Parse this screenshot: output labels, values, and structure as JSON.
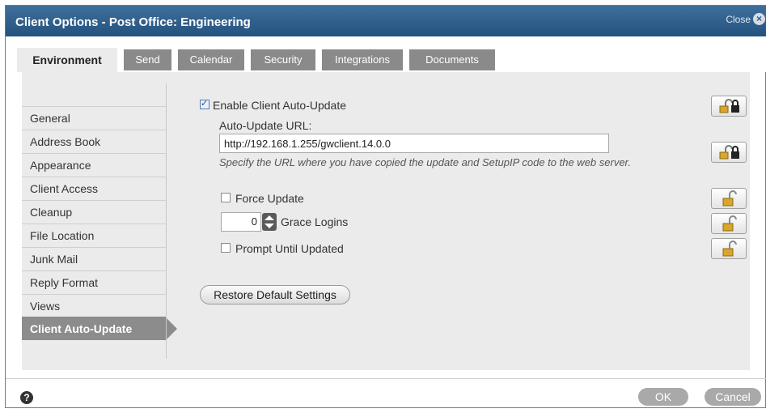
{
  "dialog": {
    "title": "Client Options - Post Office: Engineering",
    "close_label": "Close",
    "close_icon": "close-x-icon"
  },
  "tabs": [
    {
      "label": "Environment",
      "active": true
    },
    {
      "label": "Send",
      "active": false
    },
    {
      "label": "Calendar",
      "active": false
    },
    {
      "label": "Security",
      "active": false
    },
    {
      "label": "Integrations",
      "active": false
    },
    {
      "label": "Documents",
      "active": false
    }
  ],
  "nav": {
    "items": [
      {
        "label": "General",
        "active": false
      },
      {
        "label": "Address Book",
        "active": false
      },
      {
        "label": "Appearance",
        "active": false
      },
      {
        "label": "Client Access",
        "active": false
      },
      {
        "label": "Cleanup",
        "active": false
      },
      {
        "label": "File Location",
        "active": false
      },
      {
        "label": "Junk Mail",
        "active": false
      },
      {
        "label": "Reply Format",
        "active": false
      },
      {
        "label": "Views",
        "active": false
      },
      {
        "label": "Client Auto-Update",
        "active": true
      }
    ]
  },
  "settings": {
    "enable_auto_update": {
      "label": "Enable Client Auto-Update",
      "checked": true
    },
    "url_label": "Auto-Update URL:",
    "url_value": "http://192.168.1.255/gwclient.14.0.0",
    "url_hint": "Specify the URL where you have copied the update and SetupIP code to the web server.",
    "force_update": {
      "label": "Force Update",
      "checked": false
    },
    "grace_logins": {
      "value": "0",
      "label": "Grace Logins"
    },
    "prompt_until_updated": {
      "label": "Prompt Until Updated",
      "checked": false
    },
    "restore_label": "Restore Default Settings"
  },
  "locks": [
    {
      "name": "lock-enable-auto-update",
      "state": "locked"
    },
    {
      "name": "lock-auto-update-url",
      "state": "locked"
    },
    {
      "name": "lock-force-update",
      "state": "unlocked"
    },
    {
      "name": "lock-grace-logins",
      "state": "unlocked"
    },
    {
      "name": "lock-prompt-until-updated",
      "state": "unlocked"
    }
  ],
  "footer": {
    "help_icon": "?",
    "ok_label": "OK",
    "cancel_label": "Cancel"
  },
  "colors": {
    "title_bar": "#2f5f8d",
    "tab_inactive": "#8a8a8a",
    "panel_bg": "#ebebeb",
    "lock_gold": "#d8a62a"
  }
}
